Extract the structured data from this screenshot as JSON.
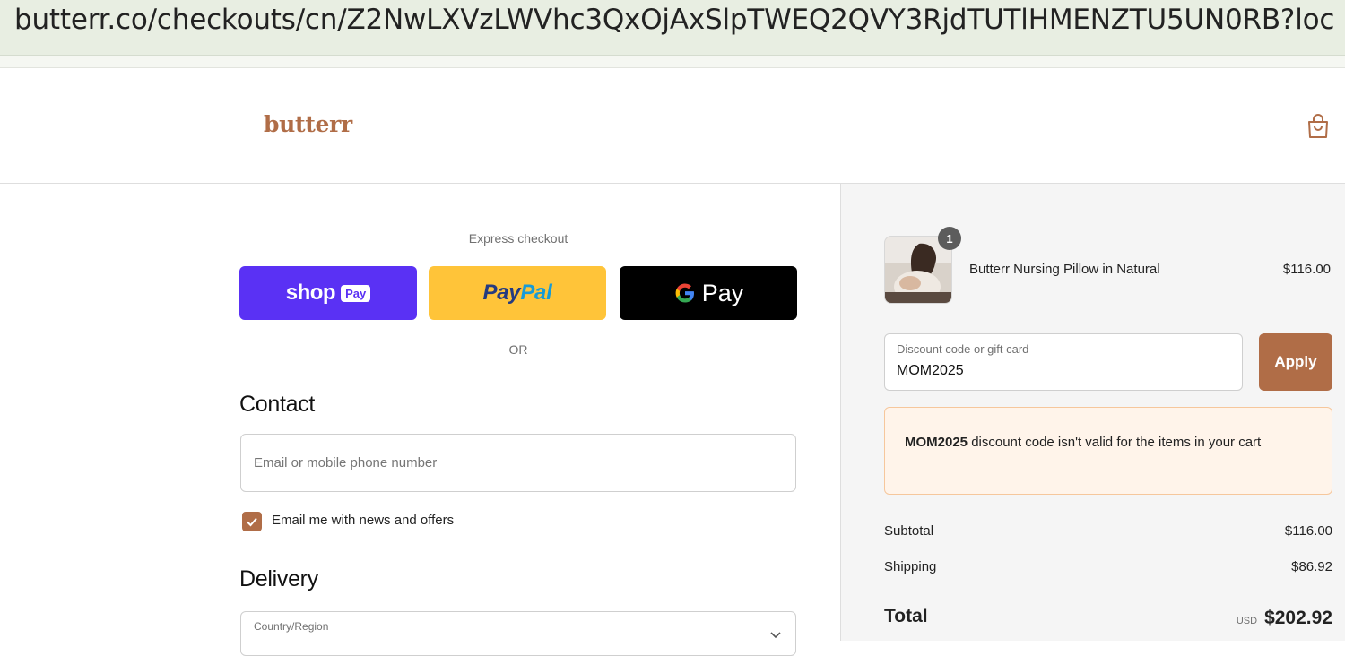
{
  "browser": {
    "url": "butterr.co/checkouts/cn/Z2NwLXVzLWVhc3QxOjAxSlpTWEQ2QVY3RjdTUTlHMENZTU5UN0RB?loc"
  },
  "header": {
    "logo": "butterr",
    "cart_icon": "shopping-bag-icon"
  },
  "express": {
    "label": "Express checkout",
    "shop_pay_main": "shop",
    "shop_pay_sub": "Pay",
    "paypal_a": "Pay",
    "paypal_b": "Pal",
    "gpay_g": "G",
    "gpay_text": "Pay",
    "or": "OR"
  },
  "contact": {
    "title": "Contact",
    "email_placeholder": "Email or mobile phone number",
    "newsletter_label": "Email me with news and offers",
    "newsletter_checked": true
  },
  "delivery": {
    "title": "Delivery",
    "country_label": "Country/Region"
  },
  "summary": {
    "item": {
      "name": "Butterr Nursing Pillow in Natural",
      "price": "$116.00",
      "quantity": "1"
    },
    "discount": {
      "label": "Discount code or gift card",
      "value": "MOM2025",
      "apply_label": "Apply"
    },
    "alert": {
      "code": "MOM2025",
      "message": " discount code isn't valid for the items in your cart"
    },
    "subtotal_label": "Subtotal",
    "subtotal_value": "$116.00",
    "shipping_label": "Shipping",
    "shipping_value": "$86.92",
    "total_label": "Total",
    "total_currency": "USD",
    "total_value": "$202.92"
  },
  "colors": {
    "brand": "#b06d47",
    "shop_pay": "#5a31f4",
    "paypal": "#ffc439",
    "gpay": "#000000",
    "alert_bg": "#fff4ea"
  }
}
